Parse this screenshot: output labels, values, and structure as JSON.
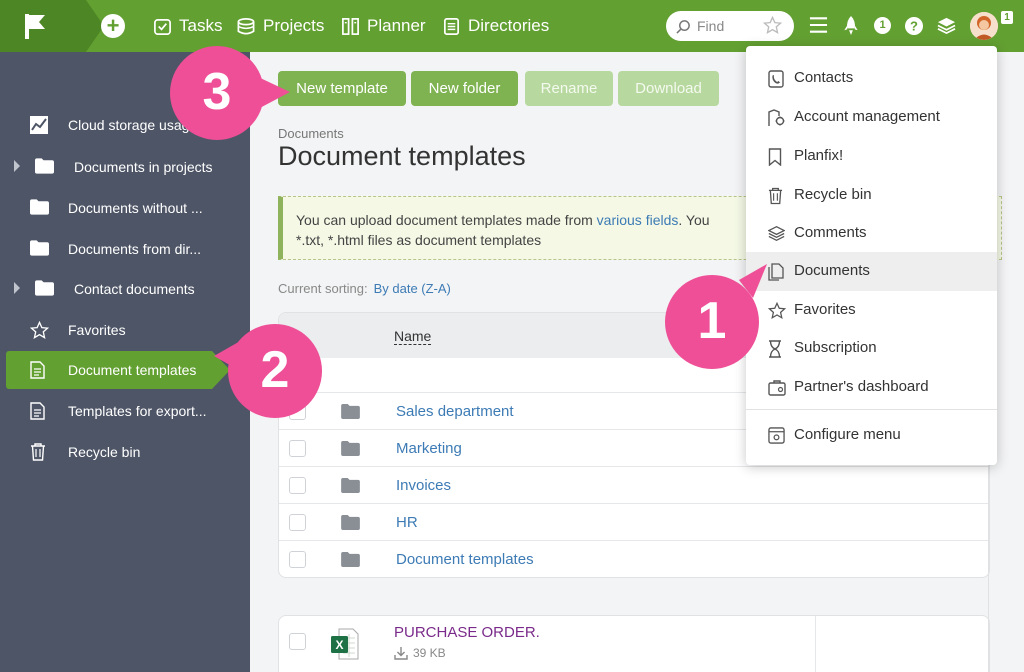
{
  "topbar": {
    "nav": [
      {
        "label": "Tasks",
        "icon": "tasks-icon"
      },
      {
        "label": "Projects",
        "icon": "projects-icon"
      },
      {
        "label": "Planner",
        "icon": "planner-icon"
      },
      {
        "label": "Directories",
        "icon": "directories-icon"
      }
    ],
    "search_placeholder": "Find",
    "avatar_badge": "1",
    "brand_color": "#63a032"
  },
  "sidebar": {
    "items": [
      {
        "label": "Cloud storage usage",
        "icon": "chart-icon"
      },
      {
        "label": "Documents in projects",
        "icon": "folder-icon"
      },
      {
        "label": "Documents without ...",
        "icon": "folder-icon"
      },
      {
        "label": "Documents from dir...",
        "icon": "folder-icon"
      },
      {
        "label": "Contact documents",
        "icon": "folder-icon"
      },
      {
        "label": "Favorites",
        "icon": "star-icon"
      },
      {
        "label": "Document templates",
        "icon": "document-icon"
      },
      {
        "label": "Templates for export...",
        "icon": "document-icon"
      },
      {
        "label": "Recycle bin",
        "icon": "trash-icon"
      }
    ]
  },
  "toolbar": {
    "new_template": "New template",
    "new_folder": "New folder",
    "rename": "Rename",
    "download": "Download"
  },
  "page": {
    "breadcrumb": "Documents",
    "title": "Document templates",
    "notice_text_1": "You can upload document templates made from ",
    "notice_link": "various fields",
    "notice_text_2": ". You",
    "notice_text_3": "*.txt, *.html files as document templates",
    "sorting_label": "Current sorting:",
    "sorting_value": "By date (Z-A)",
    "column_name": "Name"
  },
  "folders": [
    "Sales department",
    "Marketing",
    "Invoices",
    "HR",
    "Document templates"
  ],
  "file": {
    "name": "PURCHASE ORDER.",
    "size": "39 KB"
  },
  "menu": {
    "items": [
      {
        "label": "Contacts",
        "icon": "contacts-icon"
      },
      {
        "label": "Account management",
        "icon": "account-icon"
      },
      {
        "label": "Planfix!",
        "icon": "bookmark-icon"
      },
      {
        "label": "Recycle bin",
        "icon": "trash-icon"
      },
      {
        "label": "Comments",
        "icon": "layers-icon"
      },
      {
        "label": "Documents",
        "icon": "documents-icon"
      },
      {
        "label": "Favorites",
        "icon": "star-icon"
      },
      {
        "label": "Subscription",
        "icon": "hourglass-icon"
      },
      {
        "label": "Partner's dashboard",
        "icon": "dashboard-icon"
      }
    ],
    "configure": "Configure menu"
  },
  "callouts": {
    "one": "1",
    "two": "2",
    "three": "3",
    "color": "#ee4f97"
  }
}
